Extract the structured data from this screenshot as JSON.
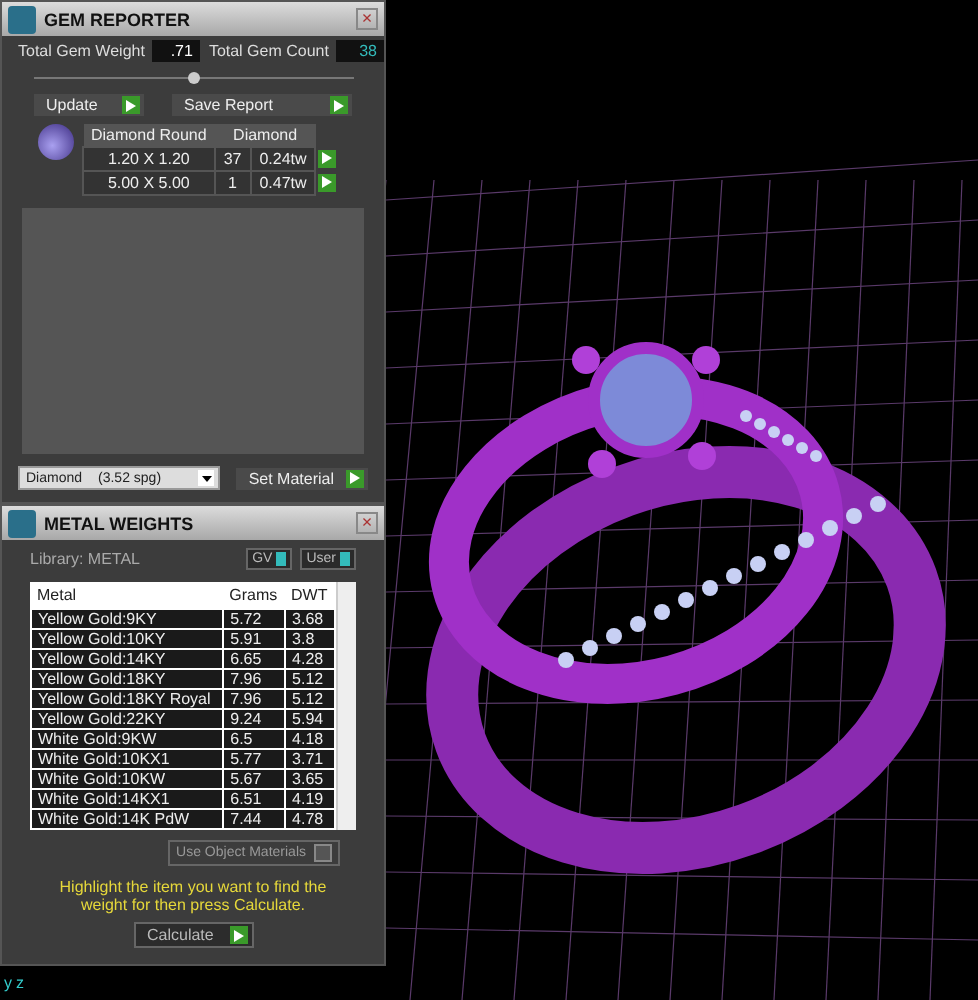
{
  "gem_reporter": {
    "title": "GEM REPORTER",
    "close": "×",
    "total_weight_label": "Total Gem Weight",
    "total_weight": ".71",
    "total_count_label": "Total Gem Count",
    "total_count": "38",
    "buttons": [
      "Update",
      "Save Report"
    ],
    "table": {
      "columns": [
        "Diamond Round",
        "Diamond"
      ],
      "rows": [
        {
          "size": "1.20 X 1.20",
          "count": "37",
          "weight": "0.24tw"
        },
        {
          "size": "5.00 X 5.00",
          "count": "1",
          "weight": "0.47tw"
        }
      ]
    },
    "material": {
      "name": "Diamond",
      "density": "(3.52 spg)"
    },
    "set_material": "Set Material"
  },
  "metal_weights": {
    "title": "METAL WEIGHTS",
    "close": "×",
    "library": "Library: METAL",
    "toggles": [
      {
        "label": "GV",
        "on": true
      },
      {
        "label": "User",
        "on": true
      }
    ],
    "columns": [
      "Metal",
      "Grams",
      "DWT"
    ],
    "rows": [
      {
        "metal": "Yellow Gold:9KY",
        "grams": "5.72",
        "dwt": "3.68"
      },
      {
        "metal": "Yellow Gold:10KY",
        "grams": "5.91",
        "dwt": "3.8"
      },
      {
        "metal": "Yellow Gold:14KY",
        "grams": "6.65",
        "dwt": "4.28"
      },
      {
        "metal": "Yellow Gold:18KY",
        "grams": "7.96",
        "dwt": "5.12"
      },
      {
        "metal": "Yellow Gold:18KY Royal",
        "grams": "7.96",
        "dwt": "5.12"
      },
      {
        "metal": "Yellow Gold:22KY",
        "grams": "9.24",
        "dwt": "5.94"
      },
      {
        "metal": "White Gold:9KW",
        "grams": "6.5",
        "dwt": "4.18"
      },
      {
        "metal": "White Gold:10KX1",
        "grams": "5.77",
        "dwt": "3.71"
      },
      {
        "metal": "White Gold:10KW",
        "grams": "5.67",
        "dwt": "3.65"
      },
      {
        "metal": "White Gold:14KX1",
        "grams": "6.51",
        "dwt": "4.19"
      },
      {
        "metal": "White Gold:14K PdW",
        "grams": "7.44",
        "dwt": "4.78"
      }
    ],
    "use_object_materials": {
      "label": "Use Object Materials",
      "checked": false
    },
    "hint": "Highlight the item you want to find the weight for then press Calculate.",
    "calculate": "Calculate"
  },
  "viewport": {
    "axis_labels": [
      "y",
      "z"
    ]
  }
}
